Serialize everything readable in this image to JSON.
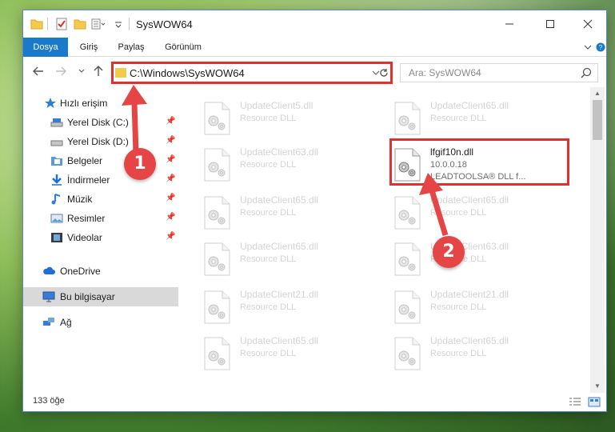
{
  "window": {
    "title": "SysWOW64",
    "controls": {
      "minimize": "—",
      "maximize": "☐",
      "close": "✕"
    }
  },
  "ribbon": {
    "tabs": [
      {
        "label": "Dosya",
        "active": true
      },
      {
        "label": "Giriş"
      },
      {
        "label": "Paylaş"
      },
      {
        "label": "Görünüm"
      }
    ],
    "help_icon": "chevron-down-icon"
  },
  "navigation": {
    "address": "C:\\Windows\\SysWOW64",
    "search_placeholder": "Ara: SysWOW64"
  },
  "sidebar": {
    "items": [
      {
        "label": "Hızlı erişim",
        "icon": "star-icon",
        "pinned": false
      },
      {
        "label": "Yerel Disk (C:)",
        "icon": "drive-icon",
        "pinned": true
      },
      {
        "label": "Yerel Disk (D:)",
        "icon": "drive-icon",
        "pinned": true
      },
      {
        "label": "Belgeler",
        "icon": "documents-icon",
        "pinned": true
      },
      {
        "label": "İndirmeler",
        "icon": "download-icon",
        "pinned": true
      },
      {
        "label": "Müzik",
        "icon": "music-icon",
        "pinned": true
      },
      {
        "label": "Resimler",
        "icon": "pictures-icon",
        "pinned": true
      },
      {
        "label": "Videolar",
        "icon": "videos-icon",
        "pinned": true
      },
      {
        "label": "OneDrive",
        "icon": "cloud-icon"
      },
      {
        "label": "Bu bilgisayar",
        "icon": "computer-icon",
        "selected": true
      },
      {
        "label": "Ağ",
        "icon": "network-icon"
      }
    ]
  },
  "files": [
    {
      "name": "UpdateClient5.dll",
      "type": "Resource DLL"
    },
    {
      "name": "UpdateClient65.dll",
      "type": "Resource DLL"
    },
    {
      "name": "UpdateClient63.dll",
      "type": "Resource DLL"
    },
    {
      "name": "lfgif10n.dll",
      "version": "10.0.0.18",
      "description": "LEADTOOLSA® DLL f...",
      "highlighted": true
    },
    {
      "name": "UpdateClient65.dll",
      "type": "Resource DLL"
    },
    {
      "name": "UpdateClient65.dll",
      "type": "Resource DLL"
    },
    {
      "name": "UpdateClient65.dll",
      "type": "Resource DLL"
    },
    {
      "name": "UpdateClient63.dll",
      "type": "Resource DLL"
    },
    {
      "name": "UpdateClient21.dll",
      "type": "Resource DLL"
    },
    {
      "name": "UpdateClient21.dll",
      "type": "Resource DLL"
    },
    {
      "name": "UpdateClient65.dll",
      "type": "Resource DLL"
    },
    {
      "name": "UpdateClient65.dll",
      "type": "Resource DLL"
    }
  ],
  "status": {
    "item_count": "133 öğe"
  },
  "annotations": {
    "step1": "1",
    "step2": "2",
    "highlight_color": "#e03030",
    "badge_color": "#e54545"
  }
}
